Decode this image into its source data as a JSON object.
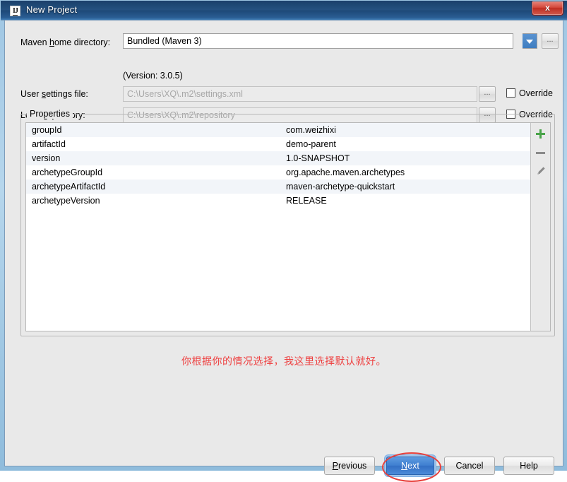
{
  "window": {
    "title": "New Project",
    "icon": "intellij-idea-icon",
    "icon_text": "IJ",
    "close_label": "x"
  },
  "form": {
    "maven_home": {
      "label_before": "Maven ",
      "label_mnemonic": "h",
      "label_after": "ome directory:",
      "value": "Bundled (Maven 3)",
      "dropdown_icon": "chevron-down-icon",
      "browse_label": "...",
      "version_text": "(Version: 3.0.5)"
    },
    "user_settings": {
      "label_before": "User ",
      "label_mnemonic": "s",
      "label_after": "ettings file:",
      "value": "C:\\Users\\XQ\\.m2\\settings.xml",
      "browse_label": "...",
      "override_label": "Override",
      "override_checked": false
    },
    "local_repository": {
      "label_before": "Local ",
      "label_mnemonic": "r",
      "label_after": "epository:",
      "value": "C:\\Users\\XQ\\.m2\\repository",
      "browse_label": "...",
      "override_label": "Override",
      "override_checked": false
    }
  },
  "properties": {
    "legend": "Properties",
    "rows": [
      {
        "key": "groupId",
        "value": "com.weizhixi"
      },
      {
        "key": "artifactId",
        "value": "demo-parent"
      },
      {
        "key": "version",
        "value": "1.0-SNAPSHOT"
      },
      {
        "key": "archetypeGroupId",
        "value": "org.apache.maven.archetypes"
      },
      {
        "key": "archetypeArtifactId",
        "value": "maven-archetype-quickstart"
      },
      {
        "key": "archetypeVersion",
        "value": "RELEASE"
      }
    ],
    "toolbar": {
      "add_icon": "plus-icon",
      "remove_icon": "minus-icon",
      "edit_icon": "pencil-icon"
    }
  },
  "annotation": {
    "note": "你根据你的情况选择，我这里选择默认就好。",
    "note_color": "#ee4040",
    "highlight_shape": "ellipse-around-next-button"
  },
  "buttons": {
    "previous": {
      "before": "",
      "mnemonic": "P",
      "after": "revious"
    },
    "next": {
      "before": "",
      "mnemonic": "N",
      "after": "ext"
    },
    "cancel": {
      "before": "Cancel",
      "mnemonic": "",
      "after": ""
    },
    "help": {
      "before": "Help",
      "mnemonic": "",
      "after": ""
    }
  },
  "colors": {
    "accent_blue": "#3f7fd0",
    "title_blue": "#1e4874",
    "annotation_red": "#ee4040",
    "add_green": "#49a349",
    "row_alt": "#f2f5f9"
  }
}
